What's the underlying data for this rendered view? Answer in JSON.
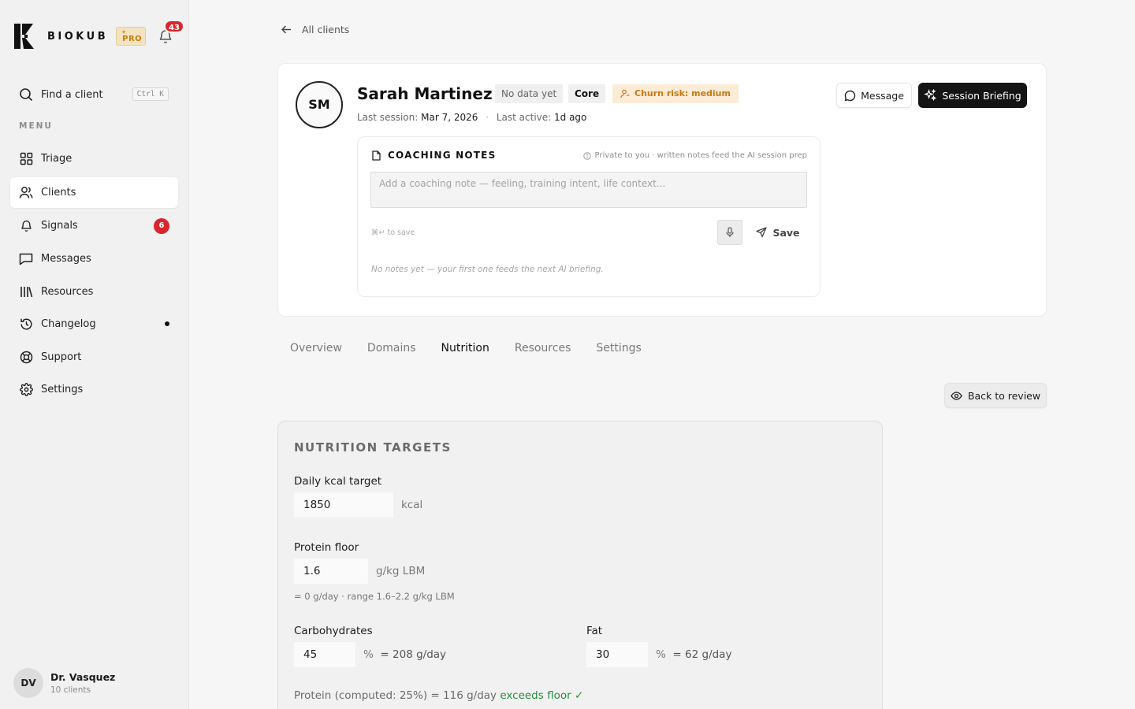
{
  "sidebar": {
    "brand": "BIOKUB",
    "plan_badge": "PRO",
    "notifications_count": "43",
    "search": {
      "label": "Find a client",
      "shortcut": "Ctrl K"
    },
    "menu_label": "MENU",
    "items": [
      {
        "label": "Triage",
        "icon": "grid-icon"
      },
      {
        "label": "Clients",
        "icon": "users-icon",
        "active": true
      },
      {
        "label": "Signals",
        "icon": "bell-icon",
        "badge": "6"
      },
      {
        "label": "Messages",
        "icon": "message-square-icon"
      },
      {
        "label": "Resources",
        "icon": "library-icon"
      },
      {
        "label": "Changelog",
        "icon": "history-icon",
        "dot": true
      },
      {
        "label": "Support",
        "icon": "life-buoy-icon"
      },
      {
        "label": "Settings",
        "icon": "gear-icon"
      }
    ],
    "user": {
      "initials": "DV",
      "name": "Dr. Vasquez",
      "sub": "10 clients"
    }
  },
  "header": {
    "back_label": "All clients",
    "client": {
      "initials": "SM",
      "name": "Sarah Martinez",
      "tags": {
        "data": "No data yet",
        "tier": "Core",
        "churn": "Churn risk: medium"
      },
      "last_session_label": "Last session:",
      "last_session_value": "Mar 7, 2026",
      "last_active_label": "Last active:",
      "last_active_value": "1d ago"
    },
    "buttons": {
      "message": "Message",
      "briefing": "Session Briefing"
    },
    "notes": {
      "title": "COACHING NOTES",
      "private_note": "Private to you · written notes feed the AI session prep",
      "placeholder": "Add a coaching note — feeling, training intent, life context...",
      "hint": "⌘↵ to save",
      "save": "Save",
      "empty": "No notes yet — your first one feeds the next AI briefing."
    }
  },
  "tabs": [
    {
      "label": "Overview"
    },
    {
      "label": "Domains"
    },
    {
      "label": "Nutrition",
      "active": true
    },
    {
      "label": "Resources"
    },
    {
      "label": "Settings"
    }
  ],
  "back_review": "Back to review",
  "targets": {
    "title": "NUTRITION TARGETS",
    "kcal": {
      "label": "Daily kcal target",
      "value": "1850",
      "unit": "kcal"
    },
    "protein": {
      "label": "Protein floor",
      "value": "1.6",
      "unit": "g/kg LBM",
      "note": "= 0 g/day · range 1.6–2.2 g/kg LBM"
    },
    "carbs": {
      "label": "Carbohydrates",
      "value": "45",
      "unit": "%",
      "per_day": "= 208 g/day"
    },
    "fat": {
      "label": "Fat",
      "value": "30",
      "unit": "%",
      "per_day": "= 62 g/day"
    },
    "computed": {
      "text": "Protein (computed: 25%) = 116 g/day",
      "status": "exceeds floor ✓"
    }
  },
  "colors": {
    "accent_dark": "#141414",
    "danger": "#d7262d",
    "warning": "#c77a14",
    "success": "#2a8a3e",
    "pro_gold": "#c47d12"
  }
}
